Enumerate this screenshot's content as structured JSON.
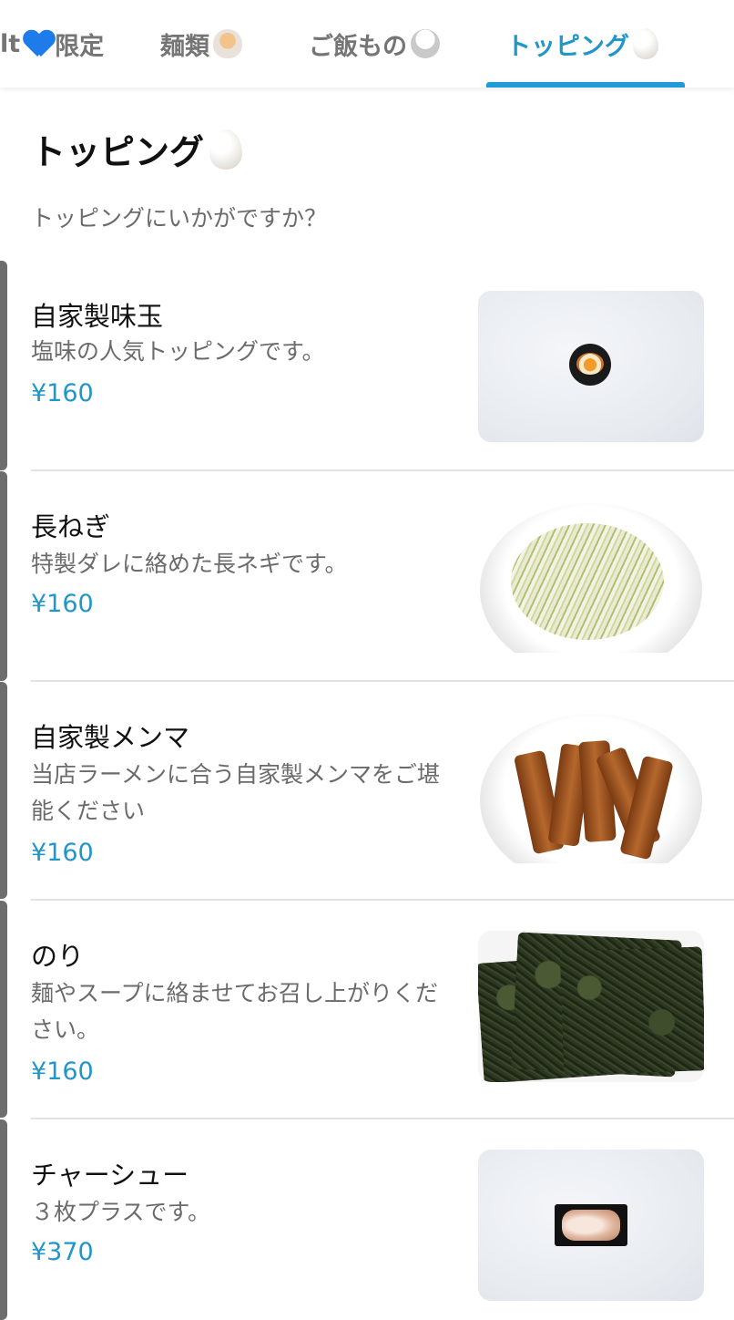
{
  "tabs": [
    {
      "label": "lt",
      "icon": "blue-heart-emoji"
    },
    {
      "label": "限定",
      "icon": ""
    },
    {
      "label": "麺類",
      "icon": "ramen-emoji"
    },
    {
      "label": "ご飯もの",
      "icon": "rice-bowl-emoji"
    },
    {
      "label": "トッピング",
      "icon": "egg-emoji",
      "active": true
    }
  ],
  "section": {
    "title": "トッピング",
    "title_icon": "egg-emoji",
    "description": "トッピングにいかがですか？"
  },
  "items": [
    {
      "name": "自家製味玉",
      "description": "塩味の人気トッピングです。",
      "price": "¥160",
      "image": "ajitama-photo"
    },
    {
      "name": "長ねぎ",
      "description": "特製ダレに絡めた長ネギです。",
      "price": "¥160",
      "image": "negi-photo"
    },
    {
      "name": "自家製メンマ",
      "description": "当店ラーメンに合う自家製メンマをご堪能ください",
      "price": "¥160",
      "image": "menma-photo"
    },
    {
      "name": "のり",
      "description": "麺やスープに絡ませてお召し上がりください。",
      "price": "¥160",
      "image": "nori-photo"
    },
    {
      "name": "チャーシュー",
      "description": "３枚プラスです。",
      "price": "¥370",
      "image": "chashu-photo"
    }
  ],
  "colors": {
    "accent": "#2196c9",
    "text_primary": "#111111",
    "text_secondary": "#6b6b6b",
    "divider": "#e2e2e2"
  }
}
